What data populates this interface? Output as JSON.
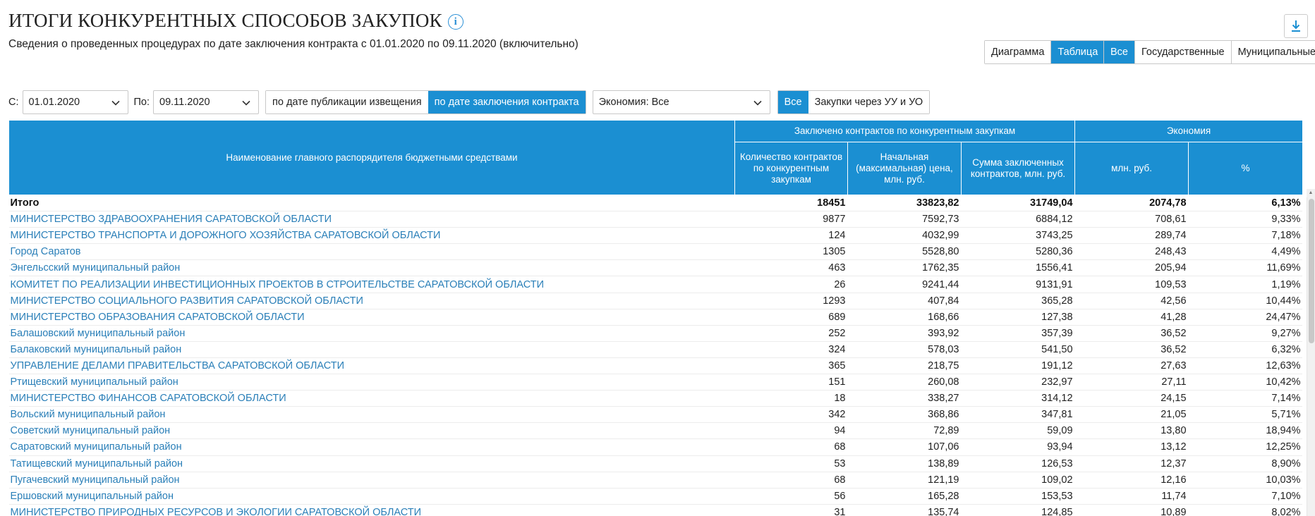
{
  "page": {
    "title": "ИТОГИ КОНКУРЕНТНЫХ СПОСОБОВ ЗАКУПОК",
    "subtitle": "Сведения о проведенных процедурах по дате заключения контракта с 01.01.2020 по 09.11.2020 (включительно)",
    "info_icon": "i"
  },
  "view_toggle": {
    "diagram": "Диаграмма",
    "table": "Таблица",
    "active": "table"
  },
  "owner_toggle": {
    "all": "Все",
    "state": "Государственные",
    "municipal": "Муниципальные",
    "active": "all"
  },
  "filters": {
    "from_label": "С:",
    "from_value": "01.01.2020",
    "to_label": "По:",
    "to_value": "09.11.2020",
    "by_publication": "по дате публикации извещения",
    "by_contract": "по дате заключения контракта",
    "economy_select": "Экономия: Все",
    "all_label": "Все",
    "via_label": "Закупки через УУ и УО"
  },
  "table": {
    "headers": {
      "name": "Наименование главного распорядителя бюджетными средствами",
      "group_contracts": "Заключено контрактов по конкурентным закупкам",
      "group_economy": "Экономия",
      "count": "Количество контрактов по конкурентным закупкам",
      "initial_price": "Начальная (максимальная) цена, млн. руб.",
      "contract_sum": "Сумма заключенных контрактов, млн. руб.",
      "economy_mln": "млн. руб.",
      "economy_pct": "%"
    },
    "total": {
      "name": "Итого",
      "count": "18451",
      "initial": "33823,82",
      "sum": "31749,04",
      "eco": "2074,78",
      "pct": "6,13%"
    },
    "rows": [
      {
        "name": "МИНИСТЕРСТВО ЗДРАВООХРАНЕНИЯ САРАТОВСКОЙ ОБЛАСТИ",
        "count": "9877",
        "initial": "7592,73",
        "sum": "6884,12",
        "eco": "708,61",
        "pct": "9,33%"
      },
      {
        "name": "МИНИСТЕРСТВО ТРАНСПОРТА И ДОРОЖНОГО ХОЗЯЙСТВА САРАТОВСКОЙ ОБЛАСТИ",
        "count": "124",
        "initial": "4032,99",
        "sum": "3743,25",
        "eco": "289,74",
        "pct": "7,18%"
      },
      {
        "name": "Город Саратов",
        "count": "1305",
        "initial": "5528,80",
        "sum": "5280,36",
        "eco": "248,43",
        "pct": "4,49%"
      },
      {
        "name": "Энгельсский муниципальный район",
        "count": "463",
        "initial": "1762,35",
        "sum": "1556,41",
        "eco": "205,94",
        "pct": "11,69%"
      },
      {
        "name": "КОМИТЕТ ПО РЕАЛИЗАЦИИ ИНВЕСТИЦИОННЫХ ПРОЕКТОВ В СТРОИТЕЛЬСТВЕ САРАТОВСКОЙ ОБЛАСТИ",
        "count": "26",
        "initial": "9241,44",
        "sum": "9131,91",
        "eco": "109,53",
        "pct": "1,19%"
      },
      {
        "name": "МИНИСТЕРСТВО СОЦИАЛЬНОГО РАЗВИТИЯ САРАТОВСКОЙ ОБЛАСТИ",
        "count": "1293",
        "initial": "407,84",
        "sum": "365,28",
        "eco": "42,56",
        "pct": "10,44%"
      },
      {
        "name": "МИНИСТЕРСТВО ОБРАЗОВАНИЯ САРАТОВСКОЙ ОБЛАСТИ",
        "count": "689",
        "initial": "168,66",
        "sum": "127,38",
        "eco": "41,28",
        "pct": "24,47%"
      },
      {
        "name": "Балашовский муниципальный район",
        "count": "252",
        "initial": "393,92",
        "sum": "357,39",
        "eco": "36,52",
        "pct": "9,27%"
      },
      {
        "name": "Балаковский муниципальный район",
        "count": "324",
        "initial": "578,03",
        "sum": "541,50",
        "eco": "36,52",
        "pct": "6,32%"
      },
      {
        "name": "УПРАВЛЕНИЕ ДЕЛАМИ ПРАВИТЕЛЬСТВА САРАТОВСКОЙ ОБЛАСТИ",
        "count": "365",
        "initial": "218,75",
        "sum": "191,12",
        "eco": "27,63",
        "pct": "12,63%"
      },
      {
        "name": "Ртищевский муниципальный район",
        "count": "151",
        "initial": "260,08",
        "sum": "232,97",
        "eco": "27,11",
        "pct": "10,42%"
      },
      {
        "name": "МИНИСТЕРСТВО ФИНАНСОВ САРАТОВСКОЙ ОБЛАСТИ",
        "count": "18",
        "initial": "338,27",
        "sum": "314,12",
        "eco": "24,15",
        "pct": "7,14%"
      },
      {
        "name": "Вольский муниципальный район",
        "count": "342",
        "initial": "368,86",
        "sum": "347,81",
        "eco": "21,05",
        "pct": "5,71%"
      },
      {
        "name": "Советский муниципальный район",
        "count": "94",
        "initial": "72,89",
        "sum": "59,09",
        "eco": "13,80",
        "pct": "18,94%"
      },
      {
        "name": "Саратовский муниципальный район",
        "count": "68",
        "initial": "107,06",
        "sum": "93,94",
        "eco": "13,12",
        "pct": "12,25%"
      },
      {
        "name": "Татищевский муниципальный район",
        "count": "53",
        "initial": "138,89",
        "sum": "126,53",
        "eco": "12,37",
        "pct": "8,90%"
      },
      {
        "name": "Пугачевский муниципальный район",
        "count": "68",
        "initial": "121,19",
        "sum": "109,02",
        "eco": "12,16",
        "pct": "10,03%"
      },
      {
        "name": "Ершовский муниципальный район",
        "count": "56",
        "initial": "165,28",
        "sum": "153,53",
        "eco": "11,74",
        "pct": "7,10%"
      },
      {
        "name": "МИНИСТЕРСТВО ПРИРОДНЫХ РЕСУРСОВ И ЭКОЛОГИИ САРАТОВСКОЙ ОБЛАСТИ",
        "count": "31",
        "initial": "135,74",
        "sum": "124,85",
        "eco": "10,89",
        "pct": "8,02%"
      }
    ]
  },
  "colors": {
    "accent": "#1b8fd2",
    "link": "#2a7fb8"
  },
  "icons": {
    "info": "info-icon",
    "download": "download-icon",
    "dropdown": "chevron-down-icon"
  }
}
